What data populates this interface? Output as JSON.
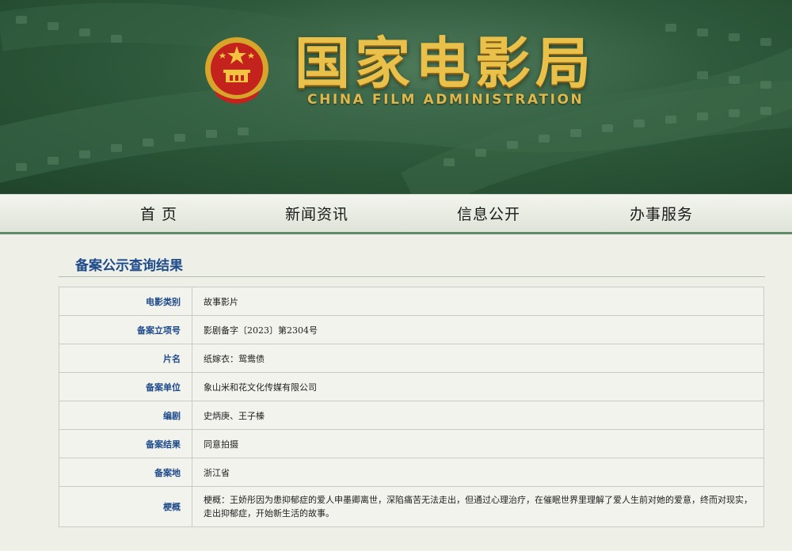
{
  "header": {
    "title_cn": "国家电影局",
    "title_en": "CHINA FILM ADMINISTRATION",
    "emblem_icon": "national-emblem-icon"
  },
  "nav": {
    "items": [
      {
        "label": "首 页"
      },
      {
        "label": "新闻资讯"
      },
      {
        "label": "信息公开"
      },
      {
        "label": "办事服务"
      }
    ]
  },
  "section": {
    "title": "备案公示查询结果"
  },
  "details": [
    {
      "label": "电影类别",
      "value": "故事影片"
    },
    {
      "label": "备案立项号",
      "value": "影剧备字〔2023〕第2304号"
    },
    {
      "label": "片名",
      "value": "纸嫁衣：鸳鸯债"
    },
    {
      "label": "备案单位",
      "value": "象山米和花文化传媒有限公司"
    },
    {
      "label": "编剧",
      "value": "史炳庚、王子榛"
    },
    {
      "label": "备案结果",
      "value": "同意拍摄"
    },
    {
      "label": "备案地",
      "value": "浙江省"
    },
    {
      "label": "梗概",
      "value": "梗概：王娇彤因为患抑郁症的爱人申墨卿离世，深陷痛苦无法走出，但通过心理治疗，在催眠世界里理解了爱人生前对她的爱意，终而对现实，走出抑郁症，开始新生活的故事。"
    }
  ],
  "colors": {
    "banner_green": "#2f5a3c",
    "title_gold": "#e8c04a",
    "label_blue": "#1e4a8a",
    "nav_underline": "#5f8a68"
  }
}
